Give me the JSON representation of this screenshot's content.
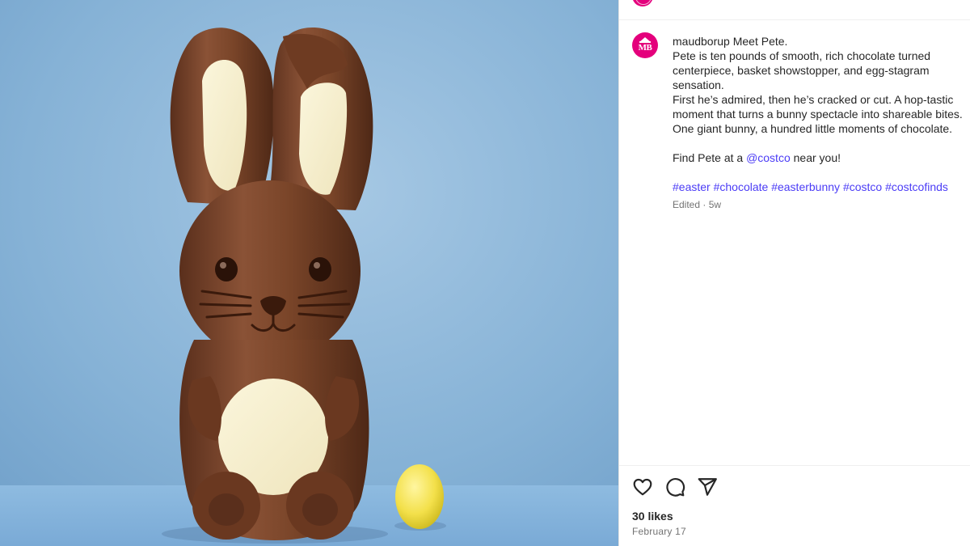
{
  "post": {
    "image_alt": "Chocolate Easter bunny with a small yellow egg",
    "top_avatar_icon": "maudborup-logo-icon",
    "author": {
      "username": "maudborup",
      "avatar_initials": "MB",
      "avatar_color": "#e4007c"
    },
    "caption": {
      "lines": [
        "Meet Pete.",
        "Pete is ten pounds of smooth, rich chocolate turned",
        "centerpiece, basket showstopper, and egg-stagram",
        "sensation.",
        "First he’s admired, then he’s cracked or cut. A hop-tastic",
        "moment that turns a bunny spectacle into shareable bites.",
        "One giant bunny, a hundred little moments of chocolate."
      ],
      "find_prefix": "Find Pete at a ",
      "find_mention": "@costco",
      "find_suffix": " near you!",
      "hashtags": [
        "#easter",
        "#chocolate",
        "#easterbunny",
        "#costco",
        "#costcofinds"
      ],
      "meta": "Edited · 5w"
    },
    "actions": {
      "like_icon": "heart-icon",
      "comment_icon": "comment-icon",
      "share_icon": "send-icon"
    },
    "likes": "30 likes",
    "date": "February 17",
    "colors": {
      "link": "#4b3cf6",
      "muted": "#737373",
      "background_photo": "#8fb6d6"
    }
  }
}
